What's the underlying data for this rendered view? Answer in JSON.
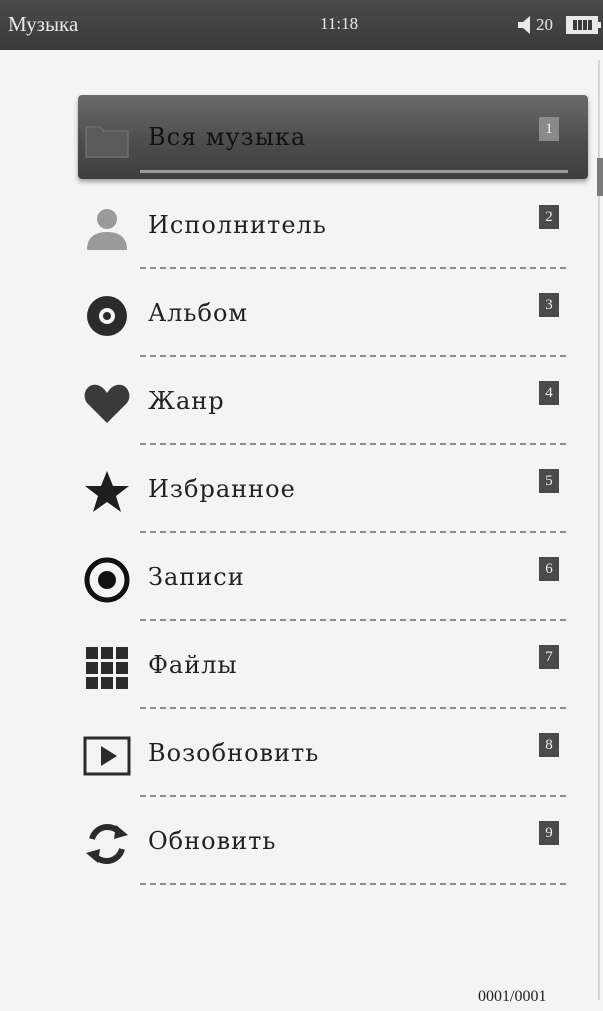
{
  "status_bar": {
    "title": "Музыка",
    "time": "11:18",
    "volume": "20",
    "battery_icon": "battery-full-icon",
    "volume_icon": "speaker-icon"
  },
  "menu": {
    "items": [
      {
        "label": "Вся музыка",
        "number": "1",
        "icon": "folder-icon",
        "selected": true
      },
      {
        "label": "Исполнитель",
        "number": "2",
        "icon": "person-icon"
      },
      {
        "label": "Альбом",
        "number": "3",
        "icon": "disc-icon"
      },
      {
        "label": "Жанр",
        "number": "4",
        "icon": "heart-icon"
      },
      {
        "label": "Избранное",
        "number": "5",
        "icon": "star-icon"
      },
      {
        "label": "Записи",
        "number": "6",
        "icon": "record-icon"
      },
      {
        "label": "Файлы",
        "number": "7",
        "icon": "grid-icon"
      },
      {
        "label": "Возобновить",
        "number": "8",
        "icon": "play-icon"
      },
      {
        "label": "Обновить",
        "number": "9",
        "icon": "refresh-icon"
      }
    ]
  },
  "page_counter": "0001/0001",
  "colors": {
    "status_bar_bg": "#3a3a3a",
    "background": "#f4f4f4",
    "selected_bg": "#4d4d4d",
    "icon": "#2b2b2b"
  }
}
